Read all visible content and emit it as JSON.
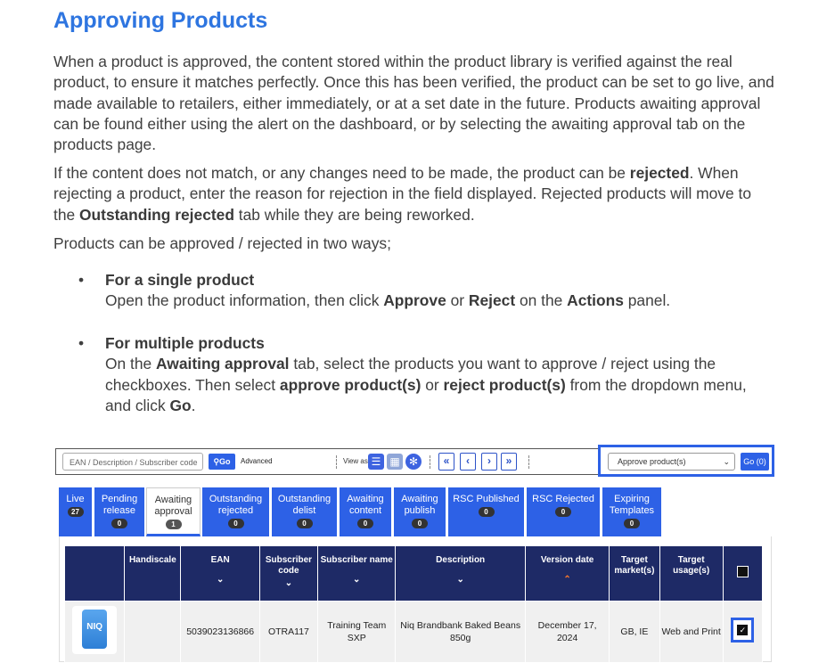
{
  "title": "Approving Products",
  "p1": "When a product is approved, the content stored within the product library is verified against the real product, to ensure it matches perfectly. Once this has been verified, the product can be set to go live, and made available to retailers, either immediately, or at a set date in the future. Products awaiting approval can be found either using the alert on the dashboard, or by selecting the awaiting approval tab on the products page.",
  "p2": {
    "a": "If the content does not match, or any changes need to be made, the product can be ",
    "b": "rejected",
    "c": ". When rejecting a product, enter the reason for rejection in the field displayed. Rejected products will move to the ",
    "d": "Outstanding rejected",
    "e": " tab while they are being reworked."
  },
  "p3": "Products can be approved / rejected in two ways;",
  "bullet1": {
    "heading": "For a single product",
    "a": "Open the product information, then click ",
    "b": "Approve",
    "c": " or ",
    "d": "Reject",
    "e": " on the ",
    "f": "Actions",
    "g": " panel."
  },
  "bullet2": {
    "heading": "For multiple products",
    "a": "On the ",
    "b": "Awaiting approval",
    "c": " tab, select the products you want to approve / reject using the checkboxes. Then select ",
    "d": "approve product(s)",
    "e": " or ",
    "f": "reject product(s)",
    "g": " from the dropdown menu, and click ",
    "h": "Go",
    "i": "."
  },
  "toolbar": {
    "search_placeholder": "EAN / Description / Subscriber code",
    "go_label": "Go",
    "advanced_label": "Advanced",
    "view_as_label": "View as",
    "nav_first": "«",
    "nav_prev": "‹",
    "nav_next": "›",
    "nav_last": "»",
    "action_select": "Approve product(s)",
    "action_go": "Go (0)"
  },
  "tabs": [
    {
      "label": "Live",
      "count": "27"
    },
    {
      "label": "Pending release",
      "count": "0"
    },
    {
      "label": "Awaiting approval",
      "count": "1"
    },
    {
      "label": "Outstanding rejected",
      "count": "0"
    },
    {
      "label": "Outstanding delist",
      "count": "0"
    },
    {
      "label": "Awaiting content",
      "count": "0"
    },
    {
      "label": "Awaiting publish",
      "count": "0"
    },
    {
      "label": "RSC Published",
      "count": "0"
    },
    {
      "label": "RSC Rejected",
      "count": "0"
    },
    {
      "label": "Expiring Templates",
      "count": "0"
    }
  ],
  "table": {
    "headers": [
      "",
      "Handiscale",
      "EAN",
      "Subscriber code",
      "Subscriber name",
      "Description",
      "Version date",
      "Target market(s)",
      "Target usage(s)",
      ""
    ],
    "row": {
      "image_label": "NIQ",
      "handiscale": "",
      "ean": "5039023136866",
      "subscriber_code": "OTRA117",
      "subscriber_name": "Training Team SXP",
      "description": "Niq Brandbank Baked Beans 850g",
      "version_date": "December 17, 2024",
      "target_markets": "GB, IE",
      "target_usages": "Web and Print"
    }
  },
  "colors": {
    "heading": "#2e75e0",
    "tab_blue": "#2d61e6",
    "table_header": "#1e2a66"
  }
}
